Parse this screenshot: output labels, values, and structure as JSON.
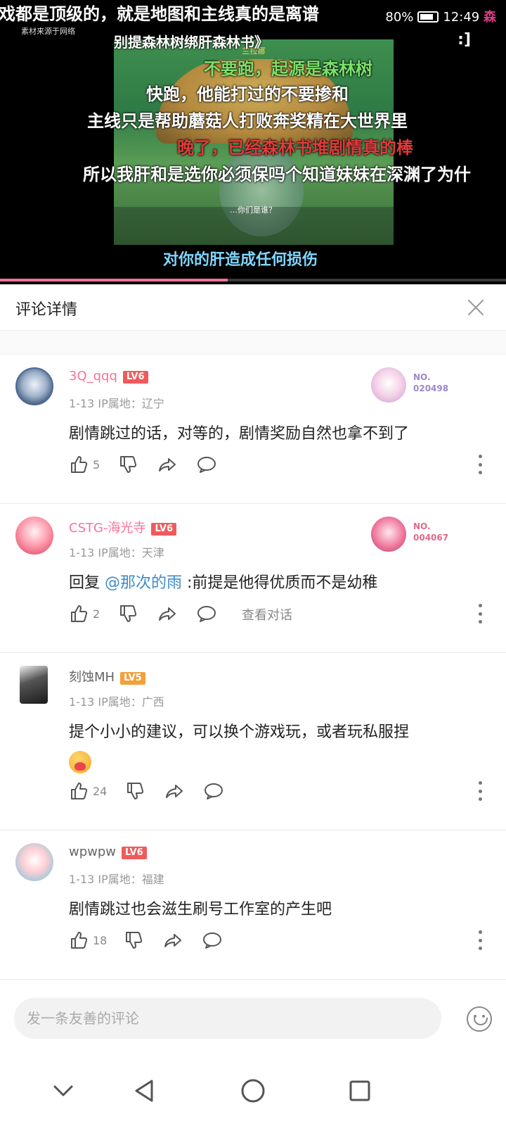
{
  "video": {
    "subtitles": [
      "戏都是顶级的，就是地图和主线真的是离谱",
      "别提森林树绑肝森林书》",
      "不要跑，起源是森林树",
      "快跑，他能打过的不要掺和",
      "主线只是帮助蘑菇人打败奔奖精在大世界里",
      "晚了，已经森林书堆剧情真的棒",
      "所以我肝和是选你必须保吗个知道妹妹在深渊了为什",
      "对你的肝造成任何损伤"
    ],
    "npc_name": "兰拉娜",
    "npc_line": "…你们是谁？",
    "watermark": "素材来源于网络",
    "more_symbol": ":]",
    "progress_fraction": 0.45
  },
  "status_bar": {
    "battery": "80%",
    "time": "12:49",
    "extra": "森"
  },
  "panel": {
    "title": "评论详情"
  },
  "colors": {
    "accent": "#fb7299",
    "mention": "#3e8bc8",
    "lv6": "#f05a5a",
    "lv5": "#f2a03c"
  },
  "comments": [
    {
      "username": "3Q_qqq",
      "username_color": "#fb7299",
      "level": "LV6",
      "date": "1-13",
      "ip_label": "IP属地：",
      "ip": "辽宁",
      "text": "剧情跳过的话，对等的，剧情奖励自然也拿不到了",
      "likes": "5",
      "badge_line1": "NO.",
      "badge_line2": "020498",
      "badge_color": "#9b89c9"
    },
    {
      "username": "CSTG-海光寺",
      "username_color": "#fb7299",
      "level": "LV6",
      "date": "1-13",
      "ip_label": "IP属地：",
      "ip": "天津",
      "reply_prefix": "回复 ",
      "mention": "@那次的雨",
      "text": " :前提是他得优质而不是幼稚",
      "likes": "2",
      "view_conversation": "查看对话",
      "badge_line1": "NO.",
      "badge_line2": "004067",
      "badge_color": "#e06a8a"
    },
    {
      "username": "刻蚀MH",
      "username_color": "#666666",
      "level": "LV5",
      "date": "1-13",
      "ip_label": "IP属地：",
      "ip": "广西",
      "text": "提个小小的建议，可以换个游戏玩，或者玩私服捏",
      "emoji": "heart-hug-emoji",
      "likes": "24"
    },
    {
      "username": "wpwpw",
      "username_color": "#666666",
      "level": "LV6",
      "date": "1-13",
      "ip_label": "IP属地：",
      "ip": "福建",
      "text": "剧情跳过也会滋生刷号工作室的产生吧",
      "likes": "18"
    }
  ],
  "input": {
    "placeholder": "发一条友善的评论"
  },
  "navbar": {
    "back": "back-icon",
    "home": "home-icon",
    "recents": "recents-icon",
    "collapse": "chevron-down-icon"
  }
}
